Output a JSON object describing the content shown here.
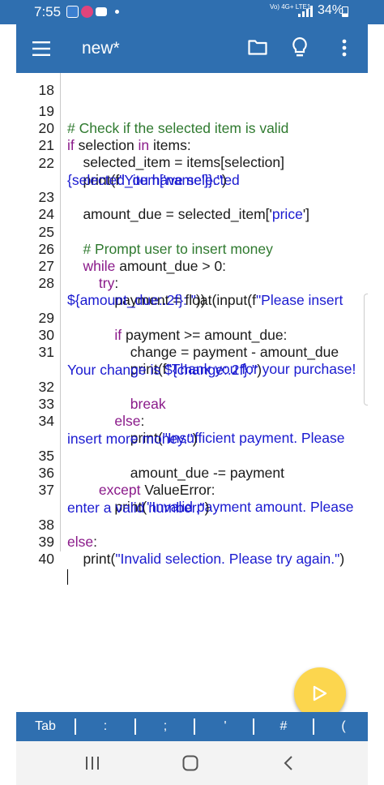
{
  "status": {
    "time": "7:55",
    "signal_text": "Vo) 4G+\nLTE1",
    "battery": "34%"
  },
  "toolbar": {
    "title": "new*",
    "menu_icon": "hamburger-menu-icon",
    "folder_icon": "folder-icon",
    "bulb_icon": "lightbulb-icon",
    "more_icon": "more-vert-icon"
  },
  "editor": {
    "lines": [
      {
        "n": "18",
        "c": ""
      },
      {
        "n": "19",
        "c": "# Check if the selected item is valid"
      },
      {
        "n": "20",
        "c": "if selection in items:"
      },
      {
        "n": "21",
        "c": "    selected_item = items[selection]"
      },
      {
        "n": "22",
        "c": "    print(f\"You have selected"
      },
      {
        "n": "",
        "c": "{selected_item['name']}.\")"
      },
      {
        "n": "23",
        "c": "    amount_due = selected_item['price']"
      },
      {
        "n": "24",
        "c": ""
      },
      {
        "n": "25",
        "c": "    # Prompt user to insert money"
      },
      {
        "n": "26",
        "c": "    while amount_due > 0:"
      },
      {
        "n": "27",
        "c": "        try:"
      },
      {
        "n": "28",
        "c": "            payment = float(input(f\"Please insert"
      },
      {
        "n": "",
        "c": "${amount_due:.2f}: \"))"
      },
      {
        "n": "29",
        "c": "            if payment >= amount_due:"
      },
      {
        "n": "30",
        "c": "                change = payment - amount_due"
      },
      {
        "n": "31",
        "c": "                print(f\"Thank you for your purchase!"
      },
      {
        "n": "",
        "c": "Your change is ${change:.2f}.\")"
      },
      {
        "n": "32",
        "c": "                break"
      },
      {
        "n": "33",
        "c": "            else:"
      },
      {
        "n": "34",
        "c": "                print(\"Insufficient payment. Please"
      },
      {
        "n": "",
        "c": "insert more money.\")"
      },
      {
        "n": "35",
        "c": "                amount_due -= payment"
      },
      {
        "n": "36",
        "c": "        except ValueError:"
      },
      {
        "n": "37",
        "c": "            print(\"Invalid payment amount. Please"
      },
      {
        "n": "",
        "c": "enter a valid number.\")"
      },
      {
        "n": "38",
        "c": "else:"
      },
      {
        "n": "39",
        "c": "    print(\"Invalid selection. Please try again.\")"
      },
      {
        "n": "40",
        "c": ""
      }
    ]
  },
  "keys": [
    "Tab",
    ":",
    ";",
    "'",
    "#",
    "("
  ],
  "fab": {
    "icon": "play-icon"
  },
  "nav": {
    "recents_icon": "recents-icon",
    "home_icon": "home-icon",
    "back_icon": "back-icon"
  },
  "colors": {
    "primary": "#2f6fb0",
    "fab": "#fcd64e",
    "keyword": "#8a1a8a",
    "comment": "#2f7a2f",
    "string": "#1a1ad0"
  }
}
